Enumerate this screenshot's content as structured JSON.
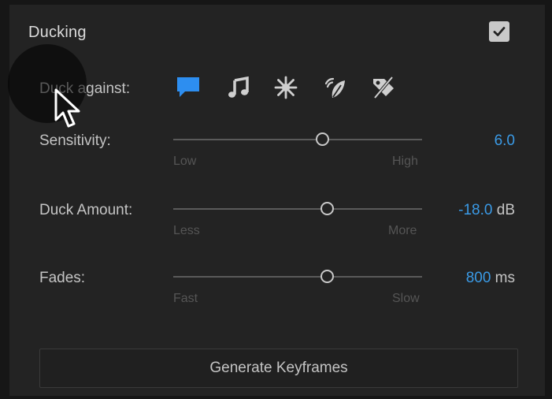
{
  "panel": {
    "title": "Ducking",
    "enabled": true
  },
  "duck_against": {
    "label": "Duck against:",
    "icons": [
      {
        "name": "dialogue-icon",
        "selected": true
      },
      {
        "name": "music-icon",
        "selected": false
      },
      {
        "name": "sfx-icon",
        "selected": false
      },
      {
        "name": "ambience-icon",
        "selected": false
      },
      {
        "name": "untagged-icon",
        "selected": false
      }
    ]
  },
  "sensitivity": {
    "label": "Sensitivity:",
    "min_label": "Low",
    "max_label": "High",
    "value": "6.0",
    "unit": "",
    "level": 0.6
  },
  "duck_amount": {
    "label": "Duck Amount:",
    "min_label": "Less",
    "max_label": "More",
    "value": "-18.0",
    "unit": "dB",
    "level": 0.62
  },
  "fades": {
    "label": "Fades:",
    "min_label": "Fast",
    "max_label": "Slow",
    "value": "800",
    "unit": "ms",
    "level": 0.62
  },
  "actions": {
    "generate_label": "Generate Keyframes"
  },
  "colors": {
    "accent": "#3a9ae6",
    "panel_bg": "#232323",
    "text": "#c4c4c4"
  }
}
